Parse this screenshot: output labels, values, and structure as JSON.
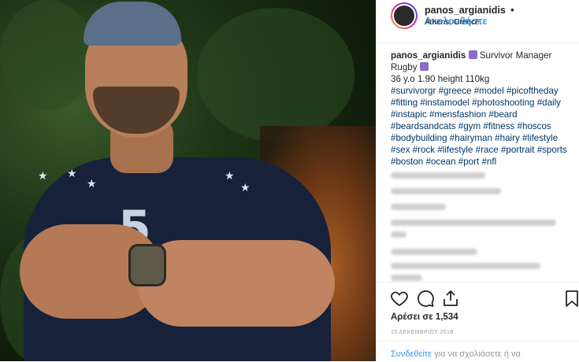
{
  "post": {
    "username": "panos_argianidis",
    "separator": "•",
    "follow_label": "Ακολουθήστε",
    "location": "Athens, Greece",
    "caption_username": "panos_argianidis",
    "caption_line1": "Survivor Manager",
    "caption_line2": "Rugby",
    "caption_line3": "36 y.o 1.90 height 110kg",
    "hashtags": [
      "#survivorgr",
      "#greece",
      "#model",
      "#picoftheday",
      "#fitting",
      "#instamodel",
      "#photoshooting",
      "#daily",
      "#instapic",
      "#mensfashion",
      "#beard",
      "#beardsandcats",
      "#gym",
      "#fitness",
      "#hoscos",
      "#bodybuilding",
      "#hairyman",
      "#hairy",
      "#lifestyle",
      "#sex",
      "#rock",
      "#lifestyle",
      "#race",
      "#portrait",
      "#sports",
      "#boston",
      "#ocean",
      "#port",
      "#nfl"
    ],
    "likes_text": "Αρέσει σε 1,534",
    "date_text": "15 ΔΕΚΕΜΒΡΙΟΥ 2018",
    "comment_link": "Συνδεθείτε",
    "comment_rest": " για να σχολιάσετε ή να"
  },
  "photo": {
    "shirt_print": "5"
  },
  "icons": {
    "like": "heart-icon",
    "comment": "comment-icon",
    "share": "share-icon",
    "save": "bookmark-icon"
  },
  "colors": {
    "accent": "#3897f0",
    "hashtag": "#003569",
    "text": "#262626",
    "muted": "#999999"
  }
}
